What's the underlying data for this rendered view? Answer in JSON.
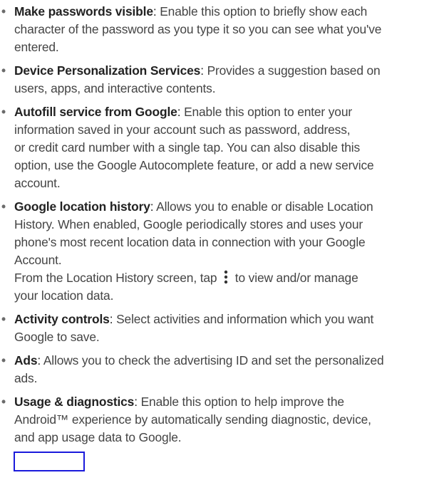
{
  "items": [
    {
      "term": "Make passwords visible",
      "lines": [
        "Enable this option to briefly show each",
        "character of the password as you type it so you can see what you've",
        "entered."
      ]
    },
    {
      "term": "Device Personalization Services",
      "lines": [
        "Provides a suggestion based on",
        "users, apps, and interactive contents."
      ]
    },
    {
      "term": "Autofill service from Google",
      "lines": [
        "Enable this option to enter your",
        "information saved in your account such as password, address,",
        "or credit card number with a single tap. You can also disable this",
        "option, use the Google Autocomplete feature, or add a new service",
        "account."
      ]
    },
    {
      "term": "Google location history",
      "lines": [
        "Allows you to enable or disable Location",
        "History. When enabled, Google periodically stores and uses your",
        "phone's most recent location data in connection with your Google",
        "Account."
      ],
      "extra_before_icon": "From the Location History screen, tap",
      "extra_after_icon": "to view and/or manage",
      "extra_line2": "your location data.",
      "icon": "more-vert-icon"
    },
    {
      "term": "Activity controls",
      "lines": [
        "Select activities and information which you want",
        "Google to save."
      ]
    },
    {
      "term": "Ads",
      "lines": [
        "Allows you to check the advertising ID and set the personalized",
        "ads."
      ]
    },
    {
      "term": "Usage & diagnostics",
      "lines": [
        "Enable this option to help improve the",
        "Android™ experience by automatically sending diagnostic, device,",
        "and app usage data to Google."
      ]
    }
  ],
  "colors": {
    "highlight_box": "#1a1adb",
    "text": "#444444",
    "term": "#222222"
  }
}
